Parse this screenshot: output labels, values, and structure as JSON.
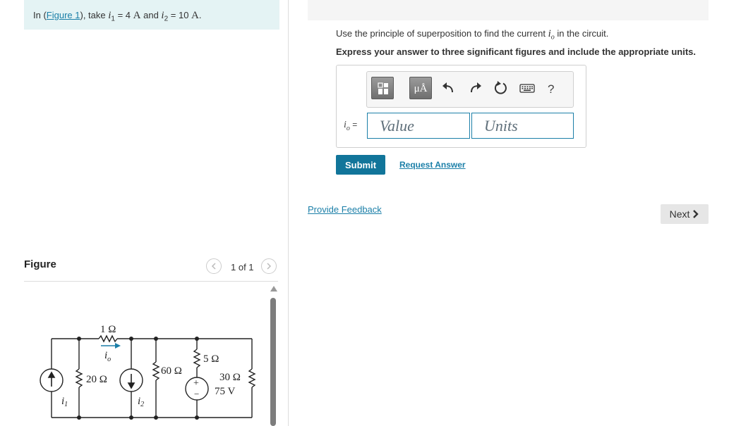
{
  "problem": {
    "prefix": "In (",
    "figure_link": "Figure 1",
    "middle": "), take ",
    "i1_symbol": "i",
    "i1_sub": "1",
    "i1_value": " = 4 ",
    "i1_unit": "A",
    "and": " and ",
    "i2_symbol": "i",
    "i2_sub": "2",
    "i2_value": " = 10 ",
    "i2_unit": "A",
    "period": "."
  },
  "part": {
    "instruction_prefix": "Use the principle of superposition to find the current ",
    "instruction_symbol": "i",
    "instruction_sub": "o",
    "instruction_suffix": " in the circuit.",
    "express": "Express your answer to three significant figures and include the appropriate units."
  },
  "toolbar": {
    "templates_icon": "templates-icon",
    "units_label": "μÅ",
    "undo_icon": "undo-icon",
    "redo_icon": "redo-icon",
    "reset_icon": "reset-icon",
    "keyboard_icon": "keyboard-icon",
    "help_label": "?"
  },
  "answer": {
    "label_symbol": "i",
    "label_sub": "o",
    "label_eq": " =",
    "value_placeholder": "Value",
    "units_placeholder": "Units",
    "value": "",
    "units": ""
  },
  "actions": {
    "submit": "Submit",
    "request_answer": "Request Answer",
    "provide_feedback": "Provide Feedback",
    "next": "Next",
    "next_icon": "chevron-right-icon"
  },
  "figure": {
    "title": "Figure",
    "pager": "1 of 1",
    "prev_icon": "chevron-left-icon",
    "next_icon": "chevron-right-icon"
  },
  "circuit": {
    "r1": "1 Ω",
    "r20": "20 Ω",
    "r60": "60 Ω",
    "r5": "5 Ω",
    "r30": "30 Ω",
    "v75": "75 V",
    "io_symbol": "i",
    "io_sub": "o",
    "i1_symbol": "i",
    "i1_sub": "1",
    "i2_symbol": "i",
    "i2_sub": "2",
    "plus": "+",
    "minus": "−"
  },
  "colors": {
    "accent": "#11759a",
    "link": "#1b7fa8",
    "problem_bg": "#e4f3f4",
    "arrow_blue": "#1b7fa8"
  }
}
